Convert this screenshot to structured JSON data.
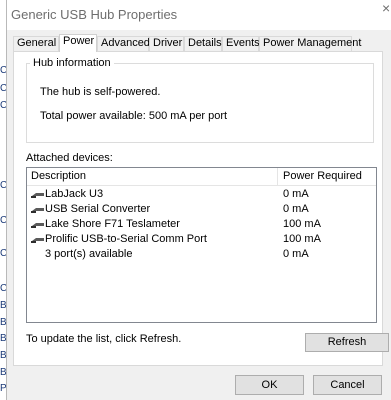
{
  "window": {
    "title": "Generic USB Hub Properties",
    "close_glyph": "×"
  },
  "tabs": [
    {
      "label": "General",
      "active": false
    },
    {
      "label": "Power",
      "active": true
    },
    {
      "label": "Advanced",
      "active": false
    },
    {
      "label": "Driver",
      "active": false
    },
    {
      "label": "Details",
      "active": false
    },
    {
      "label": "Events",
      "active": false
    },
    {
      "label": "Power Management",
      "active": false
    }
  ],
  "hub_info": {
    "legend": "Hub information",
    "power_status": "The hub is self-powered.",
    "total_power": "Total power available:  500 mA per port"
  },
  "attached": {
    "label": "Attached devices:",
    "columns": {
      "description": "Description",
      "power": "Power Required"
    },
    "rows": [
      {
        "name": "LabJack U3",
        "power": "0 mA",
        "icon": "usb-plug-icon"
      },
      {
        "name": "USB Serial Converter",
        "power": "0 mA",
        "icon": "usb-plug-icon"
      },
      {
        "name": "Lake Shore F71 Teslameter",
        "power": "100 mA",
        "icon": "usb-plug-icon"
      },
      {
        "name": "Prolific USB-to-Serial Comm Port",
        "power": "100 mA",
        "icon": "usb-plug-icon"
      },
      {
        "name": "3 port(s) available",
        "power": "0 mA",
        "icon": ""
      }
    ]
  },
  "refresh_hint": "To update the list, click Refresh.",
  "buttons": {
    "refresh": "Refresh",
    "ok": "OK",
    "cancel": "Cancel"
  },
  "background_edge_chars": [
    "C",
    "C",
    "C",
    "C",
    "C",
    "C",
    "C",
    "B",
    "B",
    "B",
    "B",
    "B",
    "P"
  ]
}
